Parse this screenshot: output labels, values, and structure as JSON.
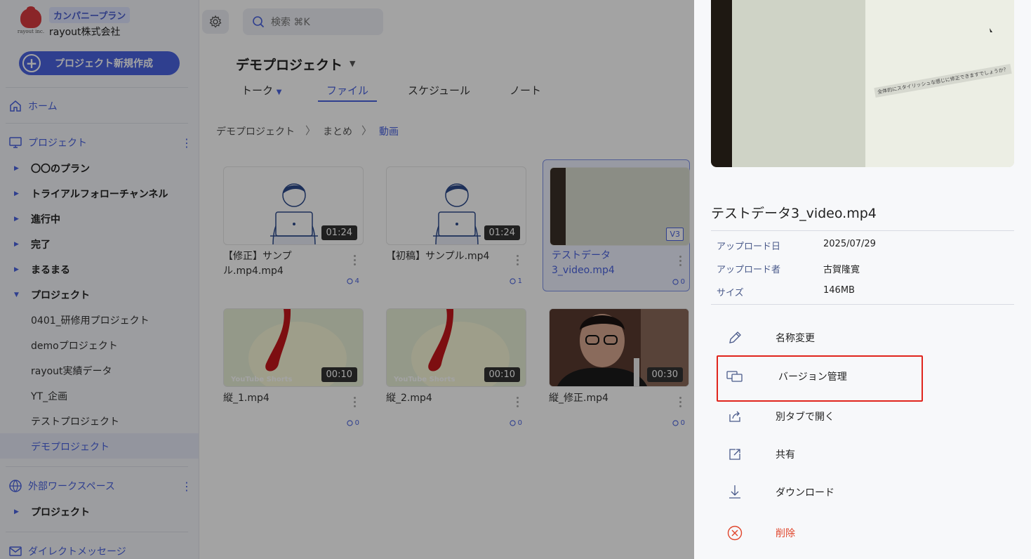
{
  "brand": {
    "plan": "カンパニープラン",
    "company": "rayout株式会社",
    "logo_caption": "rayout inc."
  },
  "search": {
    "placeholder": "検索 ⌘K"
  },
  "sidebar": {
    "new_project": "プロジェクト新規作成",
    "home": "ホーム",
    "projects_header": "プロジェクト",
    "tree": [
      "〇〇のプラン",
      "トライアルフォローチャンネル",
      "進行中",
      "完了",
      "まるまる",
      "プロジェクト"
    ],
    "sub_items": [
      "0401_研修用プロジェクト",
      "demoプロジェクト",
      "rayout実績データ",
      "YT_企画",
      "テストプロジェクト",
      "デモプロジェクト"
    ],
    "external_header": "外部ワークスペース",
    "external_tree": [
      "プロジェクト"
    ],
    "dm_header": "ダイレクトメッセージ"
  },
  "main": {
    "project_title": "デモプロジェクト",
    "tabs": [
      "トーク",
      "ファイル",
      "スケジュール",
      "ノート"
    ],
    "breadcrumb": [
      "デモプロジェクト",
      "まとめ",
      "動画"
    ],
    "files": [
      {
        "name": "【修正】サンプル.mp4.mp4",
        "duration": "01:24",
        "count": "4"
      },
      {
        "name": "【初稿】サンプル.mp4",
        "duration": "01:24",
        "count": "1"
      },
      {
        "name": "テストデータ3_video.mp4",
        "version": "V3",
        "count": "0"
      },
      {
        "name": "縦_1.mp4",
        "duration": "00:10",
        "count": "0",
        "watermark": "YouTube Shorts"
      },
      {
        "name": "縦_2.mp4",
        "duration": "00:10",
        "count": "0",
        "watermark": "YouTube Shorts"
      },
      {
        "name": "縦_修正.mp4",
        "duration": "00:30",
        "count": "0"
      }
    ]
  },
  "panel": {
    "preview_caption": "全体的にスタイリッシュな感じに修正できますでしょうか？",
    "file_title": "テストデータ3_video.mp4",
    "meta": [
      {
        "label": "アップロード日",
        "value": "2025/07/29"
      },
      {
        "label": "アップロード者",
        "value": "古賀隆寛"
      },
      {
        "label": "サイズ",
        "value": "146MB"
      }
    ],
    "actions": [
      "名称変更",
      "バージョン管理",
      "別タブで開く",
      "共有",
      "ダウンロード",
      "削除"
    ]
  },
  "colors": {
    "accent": "#4a63e0",
    "danger": "#e0452b",
    "highlight": "#e0241c"
  }
}
